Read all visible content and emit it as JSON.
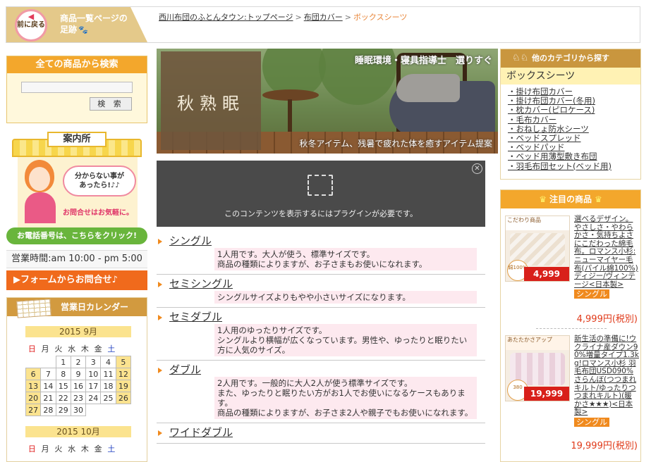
{
  "topbar": {
    "back_label": "前に戻る",
    "history_line1": "商品一覧ページの",
    "history_line2": "足跡",
    "breadcrumb": [
      {
        "label": "西川布団のふとんタウン:トップページ"
      },
      {
        "label": "布団カバー"
      },
      {
        "label": "ボックスシーツ"
      }
    ]
  },
  "search": {
    "heading": "全ての商品から検索",
    "input_value": "",
    "button_label": "検 索"
  },
  "info": {
    "sign": "案内所",
    "bubble_line1": "分からない事が",
    "bubble_line2": "あったら!♪♪",
    "note": "お問合せはお気軽に。",
    "phone_link": "お電話番号は、こちらをクリック!",
    "hours": "営業時間:am 10:00 - pm 5:00",
    "form_link": "▶フォームからお問合せ♪"
  },
  "calendar": {
    "heading": "営業日カレンダー",
    "weekdays": [
      "日",
      "月",
      "火",
      "水",
      "木",
      "金",
      "土"
    ],
    "months": [
      {
        "title": "2015  9月",
        "rows": [
          [
            "",
            "",
            "1",
            "2",
            "3",
            "4",
            "5"
          ],
          [
            "6",
            "7",
            "8",
            "9",
            "10",
            "11",
            "12"
          ],
          [
            "13",
            "14",
            "15",
            "16",
            "17",
            "18",
            "19"
          ],
          [
            "20",
            "21",
            "22",
            "23",
            "24",
            "25",
            "26"
          ],
          [
            "27",
            "28",
            "29",
            "30",
            "",
            "",
            ""
          ]
        ],
        "highlighted": [
          "5",
          "6",
          "12",
          "13",
          "19",
          "20",
          "26",
          "27"
        ]
      },
      {
        "title": "2015  10月"
      }
    ]
  },
  "hero": {
    "title": "秋熟眠",
    "tagline": "睡眠環境・寝具指導士　選りすぐ",
    "caption": "秋冬アイテム、残暑で疲れた体を癒すアイテム提案"
  },
  "plugin": {
    "message": "このコンテンツを表示するにはプラグインが必要です。"
  },
  "sizes": [
    {
      "name": "シングル",
      "desc": [
        "1人用です。大人が使う、標準サイズです。",
        "商品の種類によりますが、お子さまもお使いになれます。"
      ]
    },
    {
      "name": "セミシングル",
      "desc": [
        "シングルサイズよりもやや小さいサイズになります。"
      ]
    },
    {
      "name": "セミダブル",
      "desc": [
        "1人用のゆったりサイズです。",
        "シングルより横幅が広くなっています。男性や、ゆったりと眠りたい方に人気のサイズ。"
      ]
    },
    {
      "name": "ダブル",
      "desc": [
        "2人用です。一般的に大人2人が使う標準サイズです。",
        "また、ゆったりと眠りたい方がお1人でお使いになるケースもあります。",
        "商品の種類によりますが、お子さま2人や親子でもお使いになれます。"
      ]
    },
    {
      "name": "ワイドダブル",
      "desc": []
    }
  ],
  "categories": {
    "heading": "他のカテゴリから探す",
    "current": "ボックスシーツ",
    "items": [
      "・掛け布団カバー",
      "・掛け布団カバー(冬用)",
      "・枕カバー(ピロケース)",
      "・毛布カバー",
      "・おねしょ防水シーツ",
      "・ベッドスプレッド",
      "・ベッドパッド",
      "・ベッド用薄型敷き布団",
      "・羽毛布団セット(ベッド用)"
    ]
  },
  "featured": {
    "heading": "注目の商品",
    "products": [
      {
        "img_label": "こだわり商品",
        "img_badge": "綿100%",
        "img_price": "4,999",
        "text": "選べるデザイン。やさしさ・やわらかさ・気持ちよさにこだわった綿毛布。ロマンス小杉:ニューマイヤー毛布(パイル綿100%)ディジー/ヴィンテージ<日本製>",
        "tag": "シングル",
        "price": "4,999円(税別)"
      },
      {
        "img_label": "あたたかさアップ",
        "img_badge": "380",
        "img_price": "19,999",
        "text": "新生活の準備に!ウクライナ産ダウン90%増量タイプ1.3kg!ロマンス小杉 羽毛布団USD090%さらんぼ(つつまれキルト/ゆったりつつまれキルト)(暖かさ★★★)<日本製>",
        "tag": "シングル",
        "price": "19,999円(税別)"
      }
    ]
  }
}
